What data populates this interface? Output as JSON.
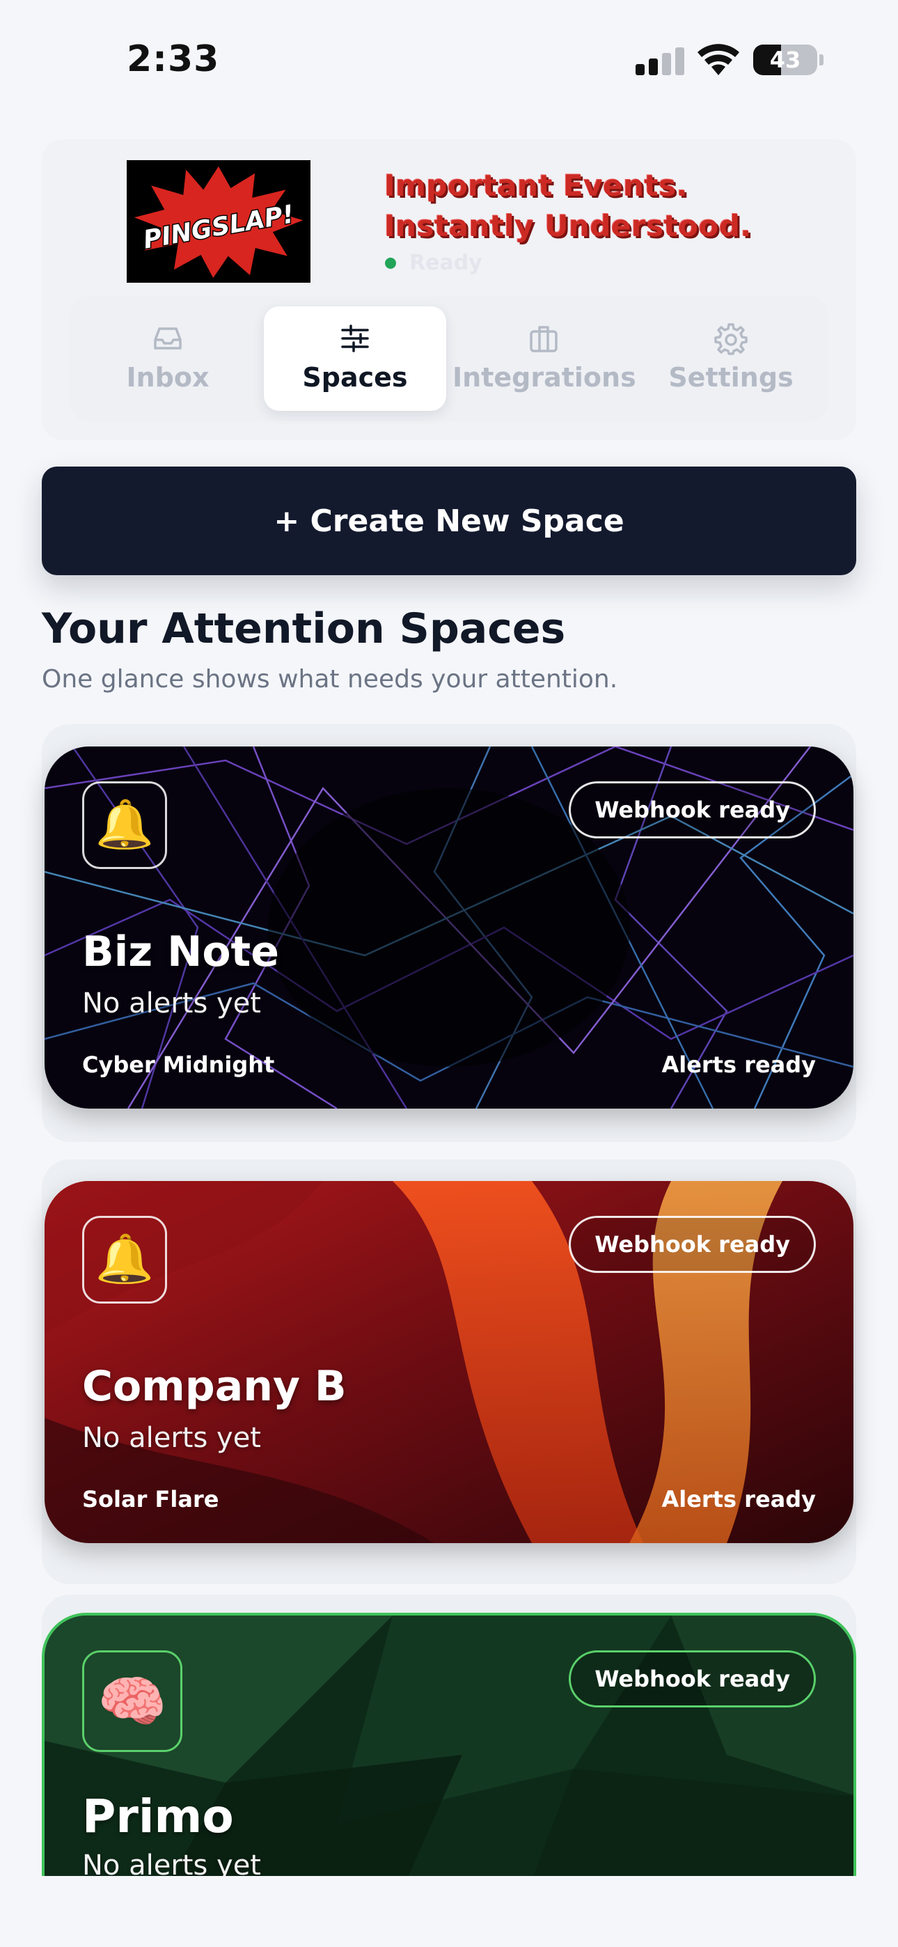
{
  "status_bar": {
    "time": "2:33",
    "battery": "43",
    "battery_level": 0.43
  },
  "header": {
    "logo_text": "PINGSLAP!",
    "tagline_line1": "Important Events.",
    "tagline_line2": "Instantly Understood.",
    "status": "Ready"
  },
  "tabs": [
    {
      "label": "Inbox",
      "icon": "inbox-icon",
      "active": false
    },
    {
      "label": "Spaces",
      "icon": "sliders-icon",
      "active": true
    },
    {
      "label": "Integrations",
      "icon": "briefcase-icon",
      "active": false
    },
    {
      "label": "Settings",
      "icon": "gear-icon",
      "active": false
    }
  ],
  "create_button": "+ Create New Space",
  "section": {
    "title": "Your Attention Spaces",
    "subtitle": "One glance shows what needs your attention."
  },
  "spaces": [
    {
      "name": "Biz Note",
      "status": "No alerts yet",
      "theme": "Cyber Midnight",
      "alerts": "Alerts ready",
      "badge": "Webhook ready",
      "icon": "🔔"
    },
    {
      "name": "Company B",
      "status": "No alerts yet",
      "theme": "Solar Flare",
      "alerts": "Alerts ready",
      "badge": "Webhook ready",
      "icon": "🔔"
    },
    {
      "name": "Primo",
      "status": "No alerts yet",
      "badge": "Webhook ready",
      "icon": "🧠"
    }
  ],
  "colors": {
    "primary_dark": "#141a2e",
    "tagline_red": "#cc2a24",
    "ready_green": "#22a559",
    "primo_border": "#3fc35a"
  }
}
